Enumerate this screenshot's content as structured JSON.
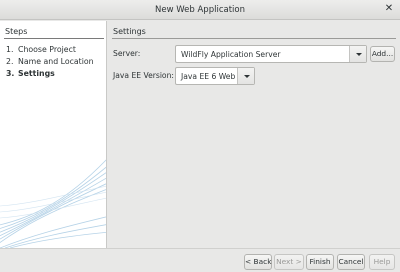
{
  "window": {
    "title": "New Web Application"
  },
  "steps": {
    "header": "Steps",
    "items": [
      {
        "num": "1.",
        "label": "Choose Project"
      },
      {
        "num": "2.",
        "label": "Name and Location"
      },
      {
        "num": "3.",
        "label": "Settings"
      }
    ],
    "current_index": 2
  },
  "settings": {
    "header": "Settings",
    "server_label": "Server:",
    "server_value": "WildFly Application Server",
    "add_label": "Add...",
    "javaee_label": "Java EE Version:",
    "javaee_value": "Java EE 6 Web"
  },
  "footer": {
    "back_label": "< Back",
    "next_label": "Next >",
    "finish_label": "Finish",
    "cancel_label": "Cancel",
    "help_label": "Help"
  },
  "icons": {
    "close": "close-icon",
    "dropdown": "chevron-down-icon"
  },
  "colors": {
    "background": "#e8e8e7",
    "panel": "#ffffff",
    "swirl": "#9cc3de"
  }
}
